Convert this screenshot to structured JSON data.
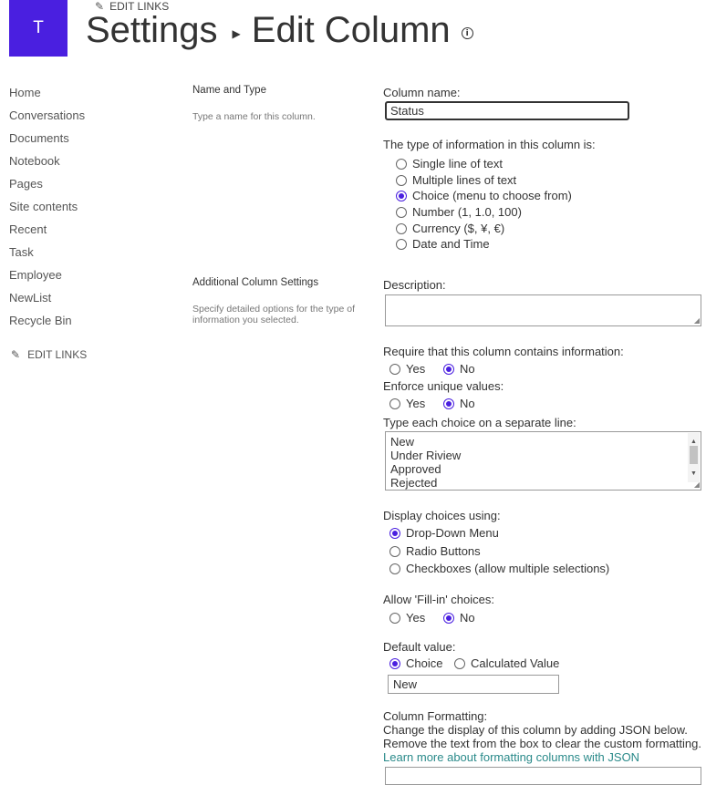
{
  "header": {
    "logo_letter": "T",
    "edit_links": "EDIT LINKS",
    "breadcrumb_root": "Settings",
    "breadcrumb_current": "Edit Column",
    "info_glyph": "i"
  },
  "nav": {
    "items": [
      "Home",
      "Conversations",
      "Documents",
      "Notebook",
      "Pages",
      "Site contents",
      "Recent",
      "Task",
      "Employee",
      "NewList",
      "Recycle Bin"
    ],
    "edit_links": "EDIT LINKS"
  },
  "sections": {
    "name_type": {
      "title": "Name and Type",
      "desc": "Type a name for this column."
    },
    "additional": {
      "title": "Additional Column Settings",
      "desc_line1": "Specify detailed options for the type of",
      "desc_line2": "information you selected."
    }
  },
  "form": {
    "column_name_label": "Column name:",
    "column_name_value": "Status",
    "type_label": "The type of information in this column is:",
    "type_options": [
      "Single line of text",
      "Multiple lines of text",
      "Choice (menu to choose from)",
      "Number (1, 1.0, 100)",
      "Currency ($, ¥, €)",
      "Date and Time"
    ],
    "type_selected": "Choice (menu to choose from)",
    "description_label": "Description:",
    "require_label": "Require that this column contains information:",
    "enforce_label": "Enforce unique values:",
    "yes": "Yes",
    "no": "No",
    "choices_label": "Type each choice on a separate line:",
    "choices": [
      "New",
      "Under Riview",
      "Approved",
      "Rejected"
    ],
    "display_label": "Display choices using:",
    "display_options": [
      "Drop-Down Menu",
      "Radio Buttons",
      "Checkboxes (allow multiple selections)"
    ],
    "display_selected": "Drop-Down Menu",
    "fillin_label": "Allow 'Fill-in' choices:",
    "default_label": "Default value:",
    "default_choice": "Choice",
    "default_calculated": "Calculated Value",
    "default_value": "New",
    "formatting_label": "Column Formatting:",
    "formatting_line1": "Change the display of this column by adding JSON below.",
    "formatting_line2": "Remove the text from the box to clear the custom formatting.",
    "formatting_link": "Learn more about formatting columns with JSON"
  },
  "colors": {
    "accent": "#4a1fe0",
    "link": "#2a8a8a"
  }
}
